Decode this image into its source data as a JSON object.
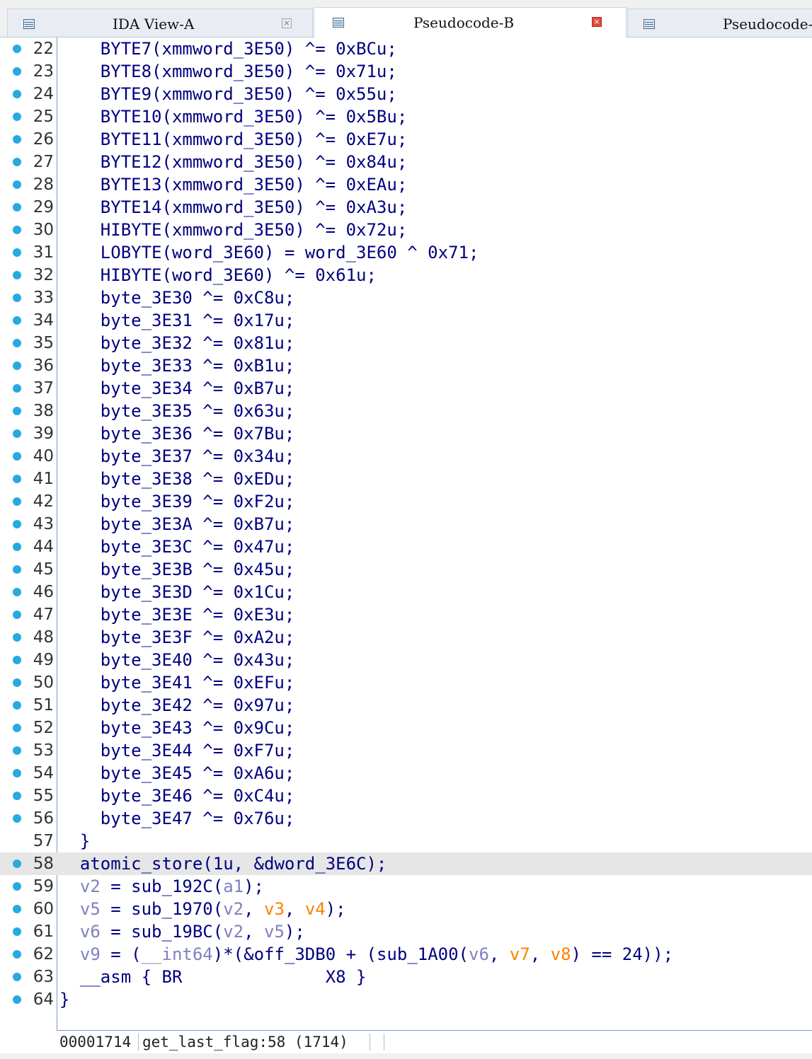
{
  "tabs": [
    {
      "label": "IDA View-A",
      "active": false
    },
    {
      "label": "Pseudocode-B",
      "active": true
    },
    {
      "label": "Pseudocode-"
    }
  ],
  "lines": [
    {
      "n": "22",
      "ind": "    ",
      "code": "BYTE7(xmmword_3E50) ^= 0xBCu;"
    },
    {
      "n": "23",
      "ind": "    ",
      "code": "BYTE8(xmmword_3E50) ^= 0x71u;"
    },
    {
      "n": "24",
      "ind": "    ",
      "code": "BYTE9(xmmword_3E50) ^= 0x55u;"
    },
    {
      "n": "25",
      "ind": "    ",
      "code": "BYTE10(xmmword_3E50) ^= 0x5Bu;"
    },
    {
      "n": "26",
      "ind": "    ",
      "code": "BYTE11(xmmword_3E50) ^= 0xE7u;"
    },
    {
      "n": "27",
      "ind": "    ",
      "code": "BYTE12(xmmword_3E50) ^= 0x84u;"
    },
    {
      "n": "28",
      "ind": "    ",
      "code": "BYTE13(xmmword_3E50) ^= 0xEAu;"
    },
    {
      "n": "29",
      "ind": "    ",
      "code": "BYTE14(xmmword_3E50) ^= 0xA3u;"
    },
    {
      "n": "30",
      "ind": "    ",
      "code": "HIBYTE(xmmword_3E50) ^= 0x72u;"
    },
    {
      "n": "31",
      "ind": "    ",
      "code": "LOBYTE(word_3E60) = word_3E60 ^ 0x71;"
    },
    {
      "n": "32",
      "ind": "    ",
      "code": "HIBYTE(word_3E60) ^= 0x61u;"
    },
    {
      "n": "33",
      "ind": "    ",
      "code": "byte_3E30 ^= 0xC8u;"
    },
    {
      "n": "34",
      "ind": "    ",
      "code": "byte_3E31 ^= 0x17u;"
    },
    {
      "n": "35",
      "ind": "    ",
      "code": "byte_3E32 ^= 0x81u;"
    },
    {
      "n": "36",
      "ind": "    ",
      "code": "byte_3E33 ^= 0xB1u;"
    },
    {
      "n": "37",
      "ind": "    ",
      "code": "byte_3E34 ^= 0xB7u;"
    },
    {
      "n": "38",
      "ind": "    ",
      "code": "byte_3E35 ^= 0x63u;"
    },
    {
      "n": "39",
      "ind": "    ",
      "code": "byte_3E36 ^= 0x7Bu;"
    },
    {
      "n": "40",
      "ind": "    ",
      "code": "byte_3E37 ^= 0x34u;"
    },
    {
      "n": "41",
      "ind": "    ",
      "code": "byte_3E38 ^= 0xEDu;"
    },
    {
      "n": "42",
      "ind": "    ",
      "code": "byte_3E39 ^= 0xF2u;"
    },
    {
      "n": "43",
      "ind": "    ",
      "code": "byte_3E3A ^= 0xB7u;"
    },
    {
      "n": "44",
      "ind": "    ",
      "code": "byte_3E3C ^= 0x47u;"
    },
    {
      "n": "45",
      "ind": "    ",
      "code": "byte_3E3B ^= 0x45u;"
    },
    {
      "n": "46",
      "ind": "    ",
      "code": "byte_3E3D ^= 0x1Cu;"
    },
    {
      "n": "47",
      "ind": "    ",
      "code": "byte_3E3E ^= 0xE3u;"
    },
    {
      "n": "48",
      "ind": "    ",
      "code": "byte_3E3F ^= 0xA2u;"
    },
    {
      "n": "49",
      "ind": "    ",
      "code": "byte_3E40 ^= 0x43u;"
    },
    {
      "n": "50",
      "ind": "    ",
      "code": "byte_3E41 ^= 0xEFu;"
    },
    {
      "n": "51",
      "ind": "    ",
      "code": "byte_3E42 ^= 0x97u;"
    },
    {
      "n": "52",
      "ind": "    ",
      "code": "byte_3E43 ^= 0x9Cu;"
    },
    {
      "n": "53",
      "ind": "    ",
      "code": "byte_3E44 ^= 0xF7u;"
    },
    {
      "n": "54",
      "ind": "    ",
      "code": "byte_3E45 ^= 0xA6u;"
    },
    {
      "n": "55",
      "ind": "    ",
      "code": "byte_3E46 ^= 0xC4u;"
    },
    {
      "n": "56",
      "ind": "    ",
      "code": "byte_3E47 ^= 0x76u;"
    },
    {
      "n": "57",
      "ind": "  ",
      "code": "}",
      "nodot": true
    },
    {
      "n": "58",
      "ind": "  ",
      "code": "atomic_store(1u, &dword_3E6C);",
      "hl": true
    },
    {
      "n": "59",
      "ind": "  ",
      "segs": [
        [
          "v",
          "v2"
        ],
        [
          "t",
          " = sub_192C("
        ],
        [
          "v",
          "a1"
        ],
        [
          "t",
          ");"
        ]
      ]
    },
    {
      "n": "60",
      "ind": "  ",
      "segs": [
        [
          "v",
          "v5"
        ],
        [
          "t",
          " = sub_1970("
        ],
        [
          "v",
          "v2"
        ],
        [
          "t",
          ", "
        ],
        [
          "a",
          "v3"
        ],
        [
          "t",
          ", "
        ],
        [
          "a",
          "v4"
        ],
        [
          "t",
          ");"
        ]
      ]
    },
    {
      "n": "61",
      "ind": "  ",
      "segs": [
        [
          "v",
          "v6"
        ],
        [
          "t",
          " = sub_19BC("
        ],
        [
          "v",
          "v2"
        ],
        [
          "t",
          ", "
        ],
        [
          "v",
          "v5"
        ],
        [
          "t",
          ");"
        ]
      ]
    },
    {
      "n": "62",
      "ind": "  ",
      "segs": [
        [
          "v",
          "v9"
        ],
        [
          "t",
          " = ("
        ],
        [
          "v",
          "__int64"
        ],
        [
          "t",
          ")*(&off_3DB0 + (sub_1A00("
        ],
        [
          "v",
          "v6"
        ],
        [
          "t",
          ", "
        ],
        [
          "a",
          "v7"
        ],
        [
          "t",
          ", "
        ],
        [
          "a",
          "v8"
        ],
        [
          "t",
          ") == 24));"
        ]
      ]
    },
    {
      "n": "63",
      "ind": "  ",
      "code": "__asm { BR              X8 }"
    },
    {
      "n": "64",
      "ind": "",
      "code": "}"
    }
  ],
  "status": {
    "address": "00001714",
    "location": "get_last_flag:58 (1714)"
  }
}
